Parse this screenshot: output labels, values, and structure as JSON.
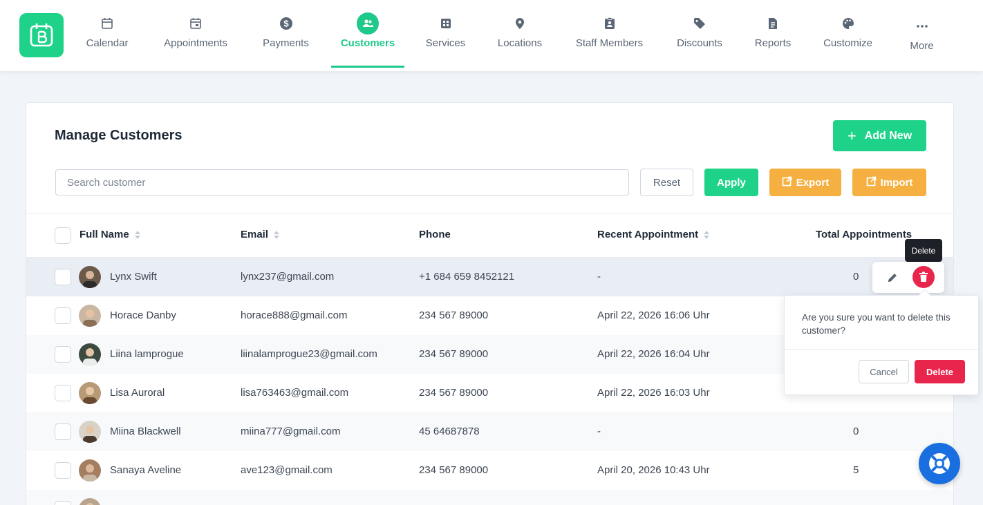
{
  "nav": {
    "items": [
      {
        "label": "Calendar",
        "icon": "calendar-icon"
      },
      {
        "label": "Appointments",
        "icon": "appointments-icon"
      },
      {
        "label": "Payments",
        "icon": "dollar-icon"
      },
      {
        "label": "Customers",
        "icon": "customers-icon",
        "active": true
      },
      {
        "label": "Services",
        "icon": "services-icon"
      },
      {
        "label": "Locations",
        "icon": "location-pin-icon"
      },
      {
        "label": "Staff Members",
        "icon": "staff-badge-icon"
      },
      {
        "label": "Discounts",
        "icon": "tag-icon"
      },
      {
        "label": "Reports",
        "icon": "report-icon"
      },
      {
        "label": "Customize",
        "icon": "palette-icon"
      },
      {
        "label": "More",
        "icon": "more-dots-icon"
      }
    ]
  },
  "colors": {
    "brand": "#1fd28a",
    "warning": "#f5b041",
    "danger": "#e8264b",
    "help": "#1a6fe0"
  },
  "page": {
    "title": "Manage Customers",
    "add_new_label": "Add New",
    "search_placeholder": "Search customer",
    "reset_label": "Reset",
    "apply_label": "Apply",
    "export_label": "Export",
    "import_label": "Import"
  },
  "table": {
    "columns": [
      "Full Name",
      "Email",
      "Phone",
      "Recent Appointment",
      "Total Appointments"
    ],
    "rows": [
      {
        "name": "Lynx Swift",
        "email": "lynx237@gmail.com",
        "phone": "+1 684 659 8452121",
        "recent": "-",
        "total": "0"
      },
      {
        "name": "Horace Danby",
        "email": "horace888@gmail.com",
        "phone": "234 567 89000",
        "recent": "April 22, 2026 16:06 Uhr",
        "total": ""
      },
      {
        "name": "Liina lamprogue",
        "email": "liinalamprogue23@gmail.com",
        "phone": "234 567 89000",
        "recent": "April 22, 2026 16:04 Uhr",
        "total": ""
      },
      {
        "name": "Lisa Auroral",
        "email": "lisa763463@gmail.com",
        "phone": "234 567 89000",
        "recent": "April 22, 2026 16:03 Uhr",
        "total": ""
      },
      {
        "name": "Miina Blackwell",
        "email": "miina777@gmail.com",
        "phone": "45 64687878",
        "recent": "-",
        "total": "0"
      },
      {
        "name": "Sanaya Aveline",
        "email": "ave123@gmail.com",
        "phone": "234 567 89000",
        "recent": "April 20, 2026 10:43 Uhr",
        "total": "5"
      }
    ]
  },
  "tooltip": "Delete",
  "confirm": {
    "message": "Are you sure you want to delete this customer?",
    "cancel_label": "Cancel",
    "delete_label": "Delete"
  }
}
